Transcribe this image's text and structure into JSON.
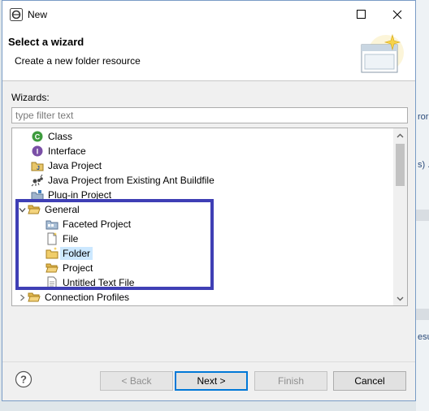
{
  "background": {
    "fragments": [
      "ror",
      "s) .",
      "esu"
    ]
  },
  "window": {
    "title": "New",
    "accent_color": "#0078d7",
    "annotation_color": "#3f3fb5"
  },
  "header": {
    "title": "Select a wizard",
    "subtitle": "Create a new folder resource"
  },
  "wizards_label": "Wizards:",
  "filter": {
    "placeholder": "type filter text",
    "value": ""
  },
  "tree": {
    "items": [
      {
        "label": "Class",
        "icon": "class-icon",
        "level": 1
      },
      {
        "label": "Interface",
        "icon": "interface-icon",
        "level": 1
      },
      {
        "label": "Java Project",
        "icon": "java-project-icon",
        "level": 1
      },
      {
        "label": "Java Project from Existing Ant Buildfile",
        "icon": "ant-icon",
        "level": 1
      },
      {
        "label": "Plug-in Project",
        "icon": "plugin-project-icon",
        "level": 1
      },
      {
        "label": "General",
        "icon": "open-folder-icon",
        "level": 0,
        "expanded": true
      },
      {
        "label": "Faceted Project",
        "icon": "faceted-project-icon",
        "level": 1
      },
      {
        "label": "File",
        "icon": "file-icon",
        "level": 1
      },
      {
        "label": "Folder",
        "icon": "folder-icon",
        "level": 1,
        "selected": true
      },
      {
        "label": "Project",
        "icon": "project-icon",
        "level": 1
      },
      {
        "label": "Untitled Text File",
        "icon": "text-file-icon",
        "level": 1
      },
      {
        "label": "Connection Profiles",
        "icon": "open-folder-icon",
        "level": 0,
        "expanded": false
      }
    ]
  },
  "buttons": {
    "back": "< Back",
    "next": "Next >",
    "finish": "Finish",
    "cancel": "Cancel"
  }
}
